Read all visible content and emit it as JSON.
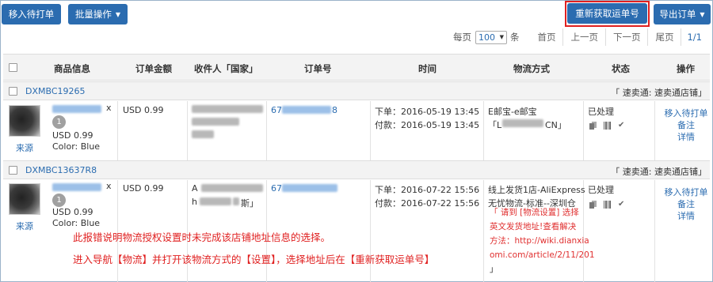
{
  "toolbar": {
    "move_pending": "移入待打单",
    "batch_ops": "批量操作",
    "reacquire_tracking": "重新获取运单号",
    "export_orders": "导出订单"
  },
  "pager": {
    "per_page_label": "每页",
    "per_page_value": "100",
    "per_page_unit": "条",
    "first": "首页",
    "prev": "上一页",
    "next": "下一页",
    "last": "尾页",
    "page_indicator": "1/1"
  },
  "table": {
    "headers": {
      "product": "商品信息",
      "amount": "订单金额",
      "recipient": "收件人「国家」",
      "order_no": "订单号",
      "time": "时间",
      "logistics": "物流方式",
      "status": "状态",
      "actions": "操作"
    }
  },
  "orders": [
    {
      "group_id": "DXMBC19265",
      "shop": "「 速卖通:  速卖通店铺」",
      "source": "来源",
      "qty": "1",
      "x": "x",
      "unit_price": "USD 0.99",
      "color": "Color: Blue",
      "amount": "USD 0.99",
      "order_no_suffix": "8",
      "order_no_prefix": "67",
      "time_order": "下单：2016-05-19 13:45",
      "time_pay": "付款：2016-05-19 13:45",
      "logistics_line1": "E邮宝-e邮宝",
      "logistics_line2_prefix": "「L",
      "logistics_line2_suffix": "CN」",
      "status": "已处理",
      "actions": [
        "移入待打单",
        "备注",
        "详情"
      ]
    },
    {
      "group_id": "DXMBC13637R8",
      "shop": "「 速卖通:  速卖通店铺」",
      "source": "来源",
      "qty": "1",
      "x": "x",
      "unit_price": "USD 0.99",
      "color": "Color: Blue",
      "amount": "USD 0.99",
      "recipient_prefix": "A",
      "recipient_mid": "h",
      "recipient_suffix": "斯」",
      "order_no_prefix": "67",
      "time_order": "下单：2016-07-22 15:56",
      "time_pay": "付款：2016-07-22 15:56",
      "logistics_line1": "线上发货1店-AliExpress",
      "logistics_line2": "无忧物流-标准--深圳仓",
      "error_lines": [
        "「 请到 [物流设置] 选择",
        "英文发货地址!查看解决",
        "方法：http://wiki.dianxia",
        "omi.com/article/2/11/201",
        "」"
      ],
      "status": "已处理",
      "actions": [
        "移入待打单",
        "备注",
        "详情"
      ]
    }
  ],
  "annotation": {
    "line1": "此报错说明物流授权设置时未完成该店铺地址信息的选择。",
    "line2": "进入导航【物流】并打开该物流方式的【设置】，选择地址后在【重新获取运单号】"
  }
}
